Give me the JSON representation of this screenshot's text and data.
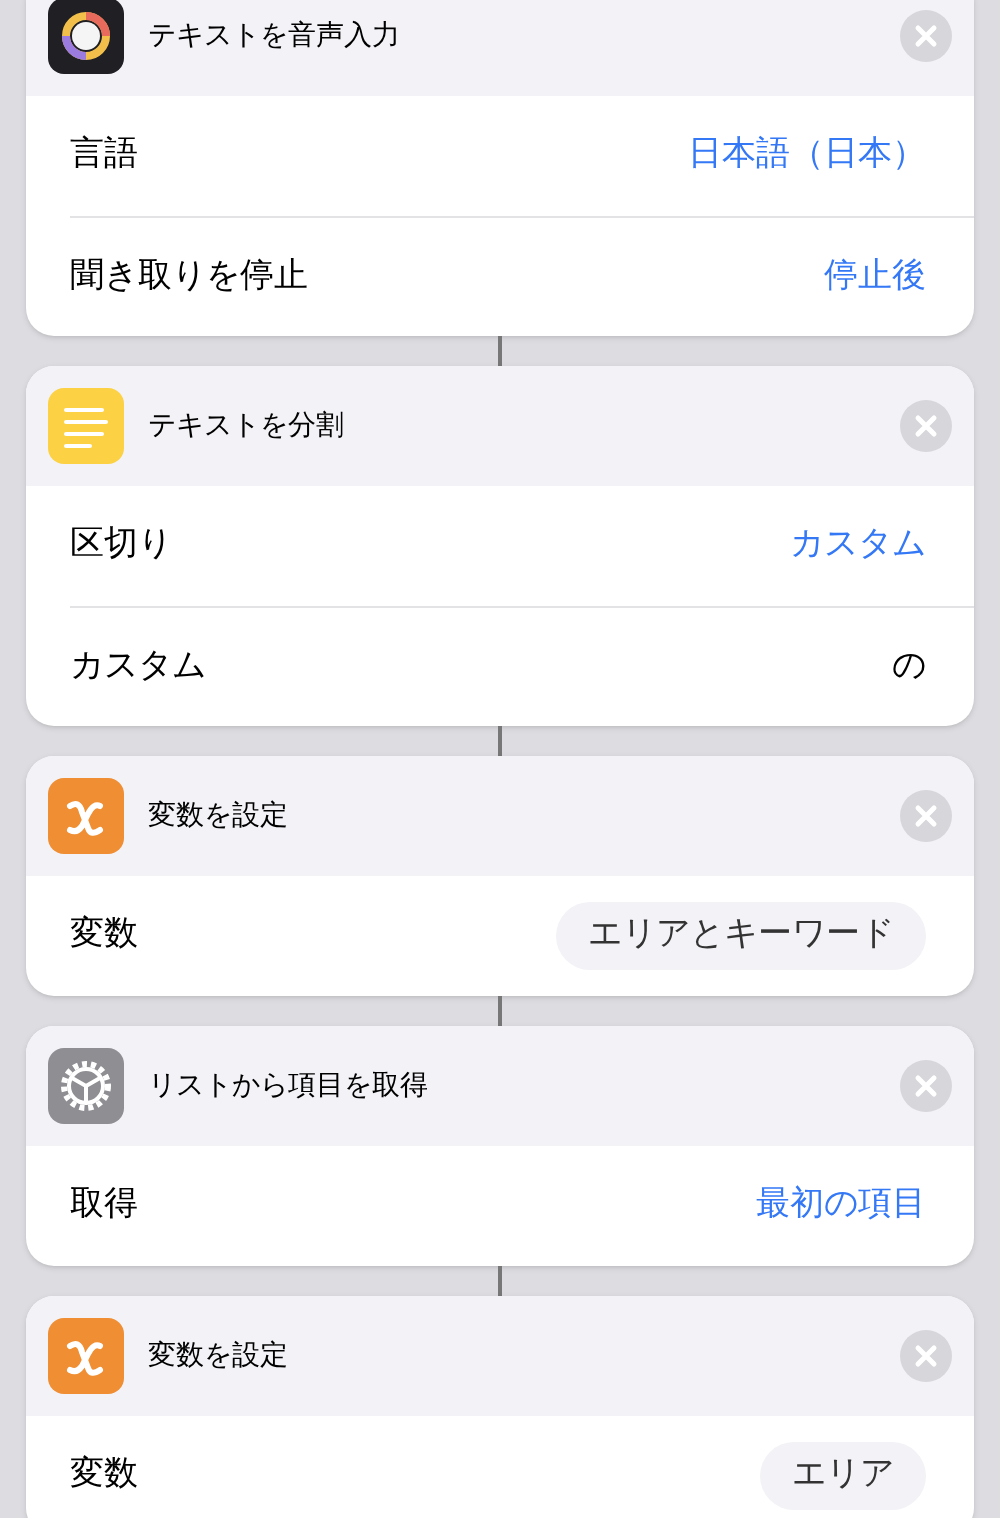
{
  "actions": [
    {
      "kind": "dictation",
      "title": "テキストを音声入力",
      "rows": [
        {
          "label": "言語",
          "kind": "link",
          "value": "日本語（日本）"
        },
        {
          "label": "聞き取りを停止",
          "kind": "link",
          "value": "停止後"
        }
      ]
    },
    {
      "kind": "text",
      "title": "テキストを分割",
      "rows": [
        {
          "label": "区切り",
          "kind": "link",
          "value": "カスタム"
        },
        {
          "label": "カスタム",
          "kind": "plain",
          "value": "の"
        }
      ]
    },
    {
      "kind": "variable",
      "title": "変数を設定",
      "rows": [
        {
          "label": "変数",
          "kind": "token",
          "value": "エリアとキーワード"
        }
      ]
    },
    {
      "kind": "gear",
      "title": "リストから項目を取得",
      "rows": [
        {
          "label": "取得",
          "kind": "link",
          "value": "最初の項目"
        }
      ]
    },
    {
      "kind": "variable",
      "title": "変数を設定",
      "rows": [
        {
          "label": "変数",
          "kind": "token",
          "value": "エリア"
        }
      ]
    }
  ]
}
